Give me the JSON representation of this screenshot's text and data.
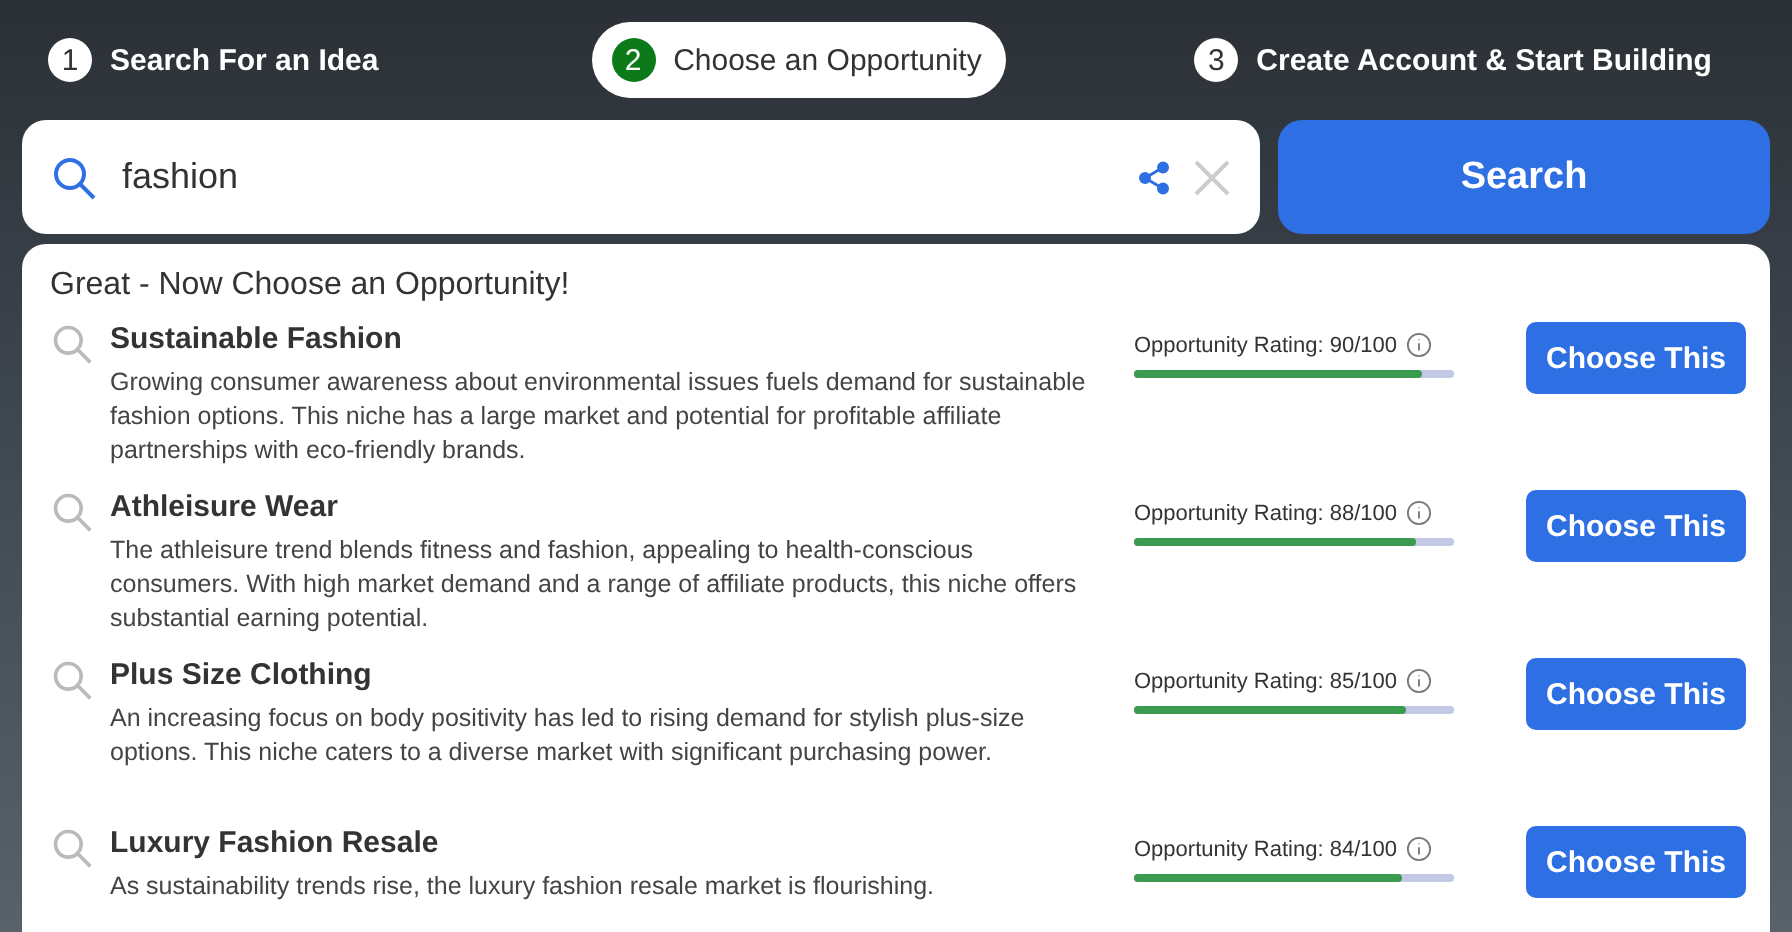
{
  "steps": [
    {
      "number": "1",
      "label": "Search For an Idea",
      "selected": false
    },
    {
      "number": "2",
      "label": "Choose an Opportunity",
      "selected": true
    },
    {
      "number": "3",
      "label": "Create Account & Start Building",
      "selected": false
    }
  ],
  "search": {
    "value": "fashion",
    "button": "Search"
  },
  "results": {
    "heading": "Great - Now Choose an Opportunity!",
    "items": [
      {
        "title": "Sustainable Fashion",
        "description": "Growing consumer awareness about environmental issues fuels demand for sustainable fashion options. This niche has a large market and potential for profitable affiliate partnerships with eco-friendly brands.",
        "rating_label": "Opportunity Rating:",
        "rating": "90/100",
        "level": 0.9,
        "button": "Choose This"
      },
      {
        "title": "Athleisure Wear",
        "description": "The athleisure trend blends fitness and fashion, appealing to health-conscious consumers. With high market demand and a range of affiliate products, this niche offers substantial earning potential.",
        "rating_label": "Opportunity Rating:",
        "rating": "88/100",
        "level": 0.88,
        "button": "Choose This"
      },
      {
        "title": "Plus Size Clothing",
        "description": "An increasing focus on body positivity has led to rising demand for stylish plus-size options. This niche caters to a diverse market with significant purchasing power.",
        "rating_label": "Opportunity Rating:",
        "rating": "85/100",
        "level": 0.85,
        "button": "Choose This"
      },
      {
        "title": "Luxury Fashion Resale",
        "description": "As sustainability trends rise, the luxury fashion resale market is flourishing.",
        "rating_label": "Opportunity Rating:",
        "rating": "84/100",
        "level": 0.84,
        "button": "Choose This"
      }
    ]
  }
}
